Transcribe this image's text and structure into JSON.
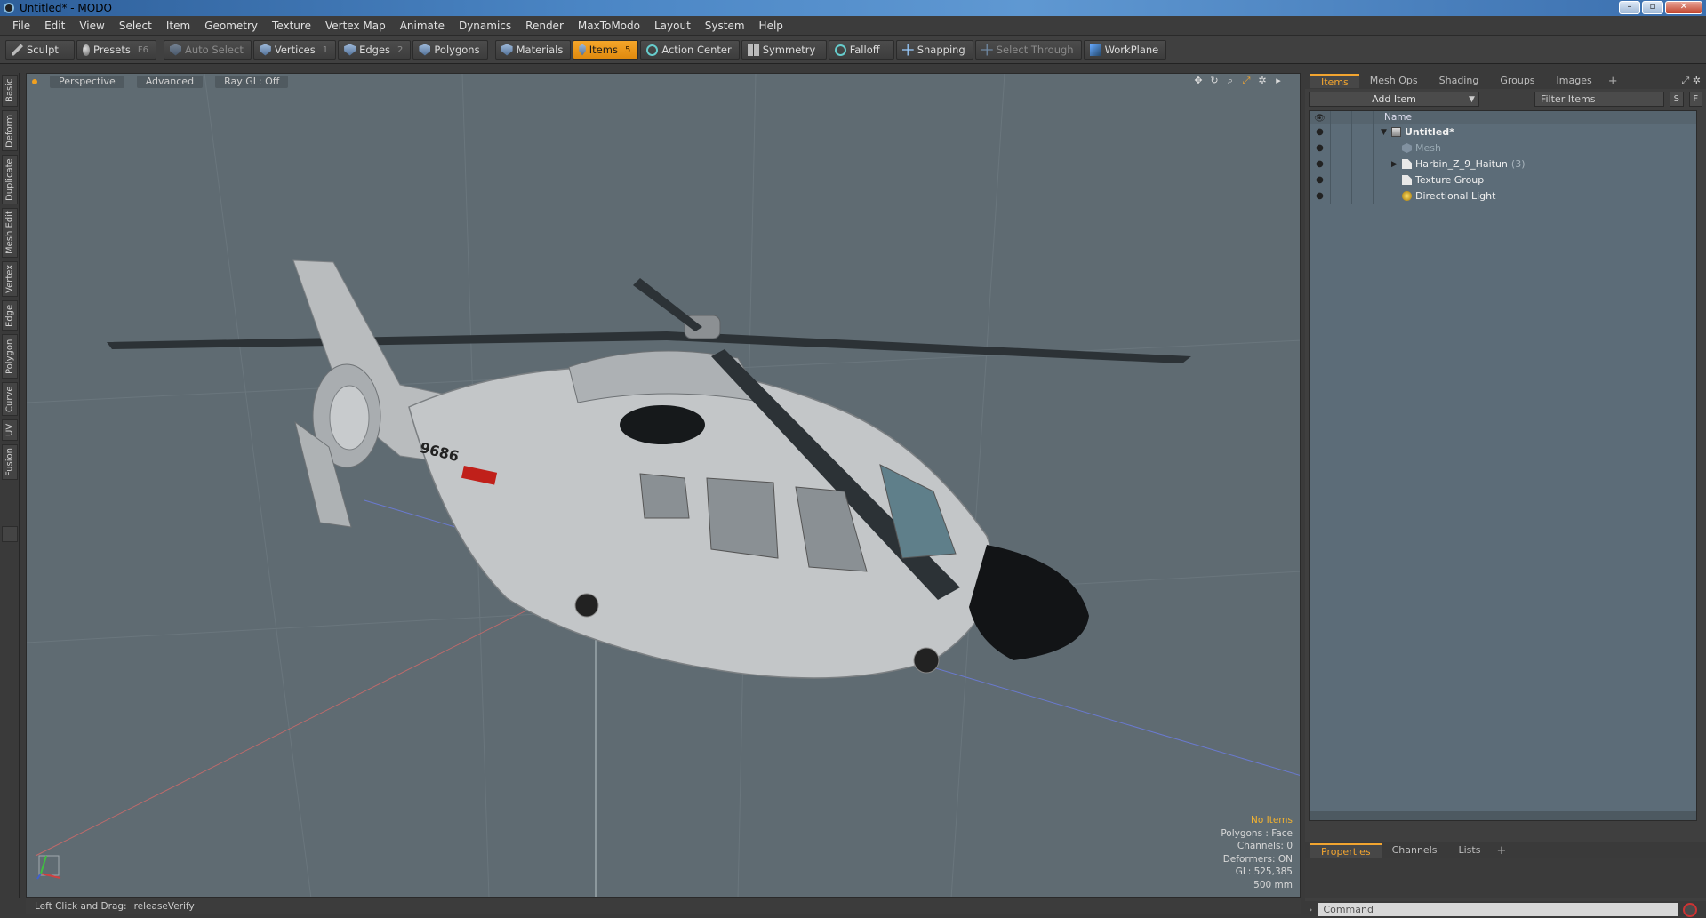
{
  "window": {
    "title": "Untitled* - MODO",
    "controls": [
      "–",
      "▫",
      "✕"
    ]
  },
  "menu": [
    "File",
    "Edit",
    "View",
    "Select",
    "Item",
    "Geometry",
    "Texture",
    "Vertex Map",
    "Animate",
    "Dynamics",
    "Render",
    "MaxToModo",
    "Layout",
    "System",
    "Help"
  ],
  "toolbar": {
    "sculpt": "Sculpt",
    "presets": "Presets",
    "presets_key": "F6",
    "auto_select": "Auto Select",
    "vertices": "Vertices",
    "vertices_key": "1",
    "edges": "Edges",
    "edges_key": "2",
    "polygons": "Polygons",
    "materials": "Materials",
    "items": "Items",
    "items_key": "5",
    "action_center": "Action Center",
    "symmetry": "Symmetry",
    "falloff": "Falloff",
    "snapping": "Snapping",
    "select_through": "Select Through",
    "workplane": "WorkPlane"
  },
  "left_tabs": [
    "Basic",
    "Deform",
    "Duplicate",
    "Mesh Edit",
    "Vertex",
    "Edge",
    "Polygon",
    "Curve",
    "UV",
    "Fusion"
  ],
  "viewport": {
    "view": "Perspective",
    "mode": "Advanced",
    "raygl": "Ray GL: Off",
    "tail_number": "9686",
    "stats": {
      "no_items": "No Items",
      "polygons": "Polygons : Face",
      "channels": "Channels: 0",
      "deformers": "Deformers: ON",
      "gl": "GL: 525,385",
      "scale": "500 mm"
    }
  },
  "status": {
    "hint_label": "Left Click and Drag:",
    "hint_value": "releaseVerify"
  },
  "panel": {
    "tabs": [
      "Items",
      "Mesh Ops",
      "Shading",
      "Groups",
      "Images"
    ],
    "add_tab": "+",
    "add_item": "Add Item",
    "filter_placeholder": "Filter Items",
    "s_btn": "S",
    "f_btn": "F",
    "name_header": "Name",
    "tree": [
      {
        "label": "Untitled*",
        "icon": "scene-icon"
      },
      {
        "label": "Mesh",
        "icon": "mesh-icon"
      },
      {
        "label": "Harbin_Z_9_Haitun",
        "count": "(3)",
        "icon": "group-icon"
      },
      {
        "label": "Texture Group",
        "icon": "group-icon"
      },
      {
        "label": "Directional Light",
        "icon": "light-icon"
      }
    ],
    "bottom_tabs": [
      "Properties",
      "Channels",
      "Lists"
    ],
    "command_placeholder": "Command"
  },
  "colors": {
    "accent": "#f2a530",
    "viewport_bg": "#5f6b72",
    "tree_bg": "#5c6c78"
  }
}
